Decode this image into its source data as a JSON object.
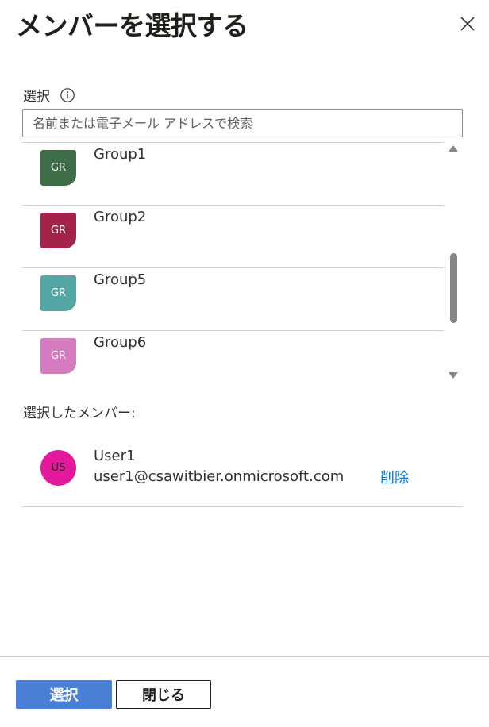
{
  "panel": {
    "title": "メンバーを選択する"
  },
  "select": {
    "label": "選択",
    "search_placeholder": "名前または電子メール アドレスで検索"
  },
  "results": [
    {
      "name": "Group1",
      "initials": "GR",
      "color": "#3d6e47"
    },
    {
      "name": "Group2",
      "initials": "GR",
      "color": "#a4234a"
    },
    {
      "name": "Group5",
      "initials": "GR",
      "color": "#55a7a6"
    },
    {
      "name": "Group6",
      "initials": "GR",
      "color": "#d57cc0"
    }
  ],
  "selected_section": {
    "label": "選択したメンバー:",
    "members": [
      {
        "initials": "US",
        "name": "User1",
        "email": "user1@csawitbier.onmicrosoft.com",
        "remove_label": "削除",
        "color": "#e3189b"
      }
    ]
  },
  "footer": {
    "select_button": "選択",
    "close_button": "閉じる"
  },
  "colors": {
    "accent": "#4a7fd6",
    "link": "#0078d4"
  }
}
